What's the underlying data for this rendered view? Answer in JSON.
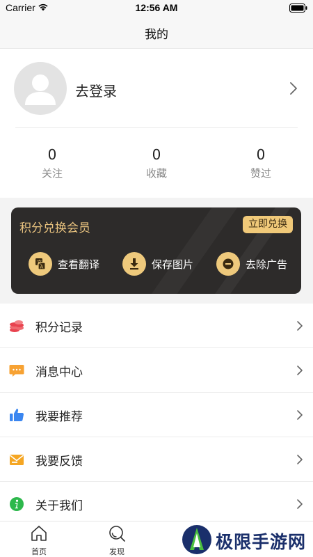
{
  "status_bar": {
    "carrier": "Carrier",
    "time": "12:56 AM"
  },
  "nav": {
    "title": "我的"
  },
  "profile": {
    "login_label": "去登录"
  },
  "stats": [
    {
      "value": "0",
      "label": "关注"
    },
    {
      "value": "0",
      "label": "收藏"
    },
    {
      "value": "0",
      "label": "赞过"
    }
  ],
  "vip": {
    "title": "积分兑换会员",
    "exchange_label": "立即兑换",
    "features": [
      {
        "label": "查看翻译",
        "icon": "translate-icon"
      },
      {
        "label": "保存图片",
        "icon": "download-icon"
      },
      {
        "label": "去除广告",
        "icon": "remove-ad-icon"
      }
    ]
  },
  "menu": [
    {
      "label": "积分记录",
      "icon": "coins-icon",
      "color": "#e8434f"
    },
    {
      "label": "消息中心",
      "icon": "message-icon",
      "color": "#f7a233"
    },
    {
      "label": "我要推荐",
      "icon": "thumbs-up-icon",
      "color": "#3b86f0"
    },
    {
      "label": "我要反馈",
      "icon": "feedback-mail-icon",
      "color": "#f5a623"
    },
    {
      "label": "关于我们",
      "icon": "info-icon",
      "color": "#2db84c"
    }
  ],
  "tabs": [
    {
      "label": "首页",
      "icon": "home-icon"
    },
    {
      "label": "发现",
      "icon": "discover-search-icon"
    }
  ],
  "watermark": {
    "text": "极限手游网"
  },
  "colors": {
    "accent_gold": "#eec97c",
    "vip_bg": "#2d2b2a"
  }
}
